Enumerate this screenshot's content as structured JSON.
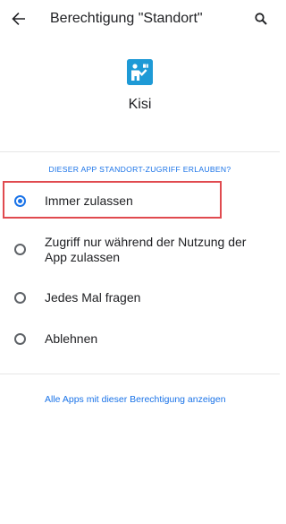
{
  "header": {
    "title": "Berechtigung \"Standort\""
  },
  "app": {
    "name": "Kisi",
    "icon": "kisi-app-icon"
  },
  "section": {
    "label": "DIESER APP STANDORT-ZUGRIFF ERLAUBEN?"
  },
  "options": [
    {
      "label": "Immer zulassen",
      "selected": true
    },
    {
      "label": "Zugriff nur während der Nutzung der App zulassen",
      "selected": false
    },
    {
      "label": "Jedes Mal fragen",
      "selected": false
    },
    {
      "label": "Ablehnen",
      "selected": false
    }
  ],
  "footer": {
    "link": "Alle Apps mit dieser Berechtigung anzeigen"
  },
  "colors": {
    "accent": "#1a73e8",
    "highlight": "#e04a4f",
    "app_icon": "#1e9ad6"
  }
}
